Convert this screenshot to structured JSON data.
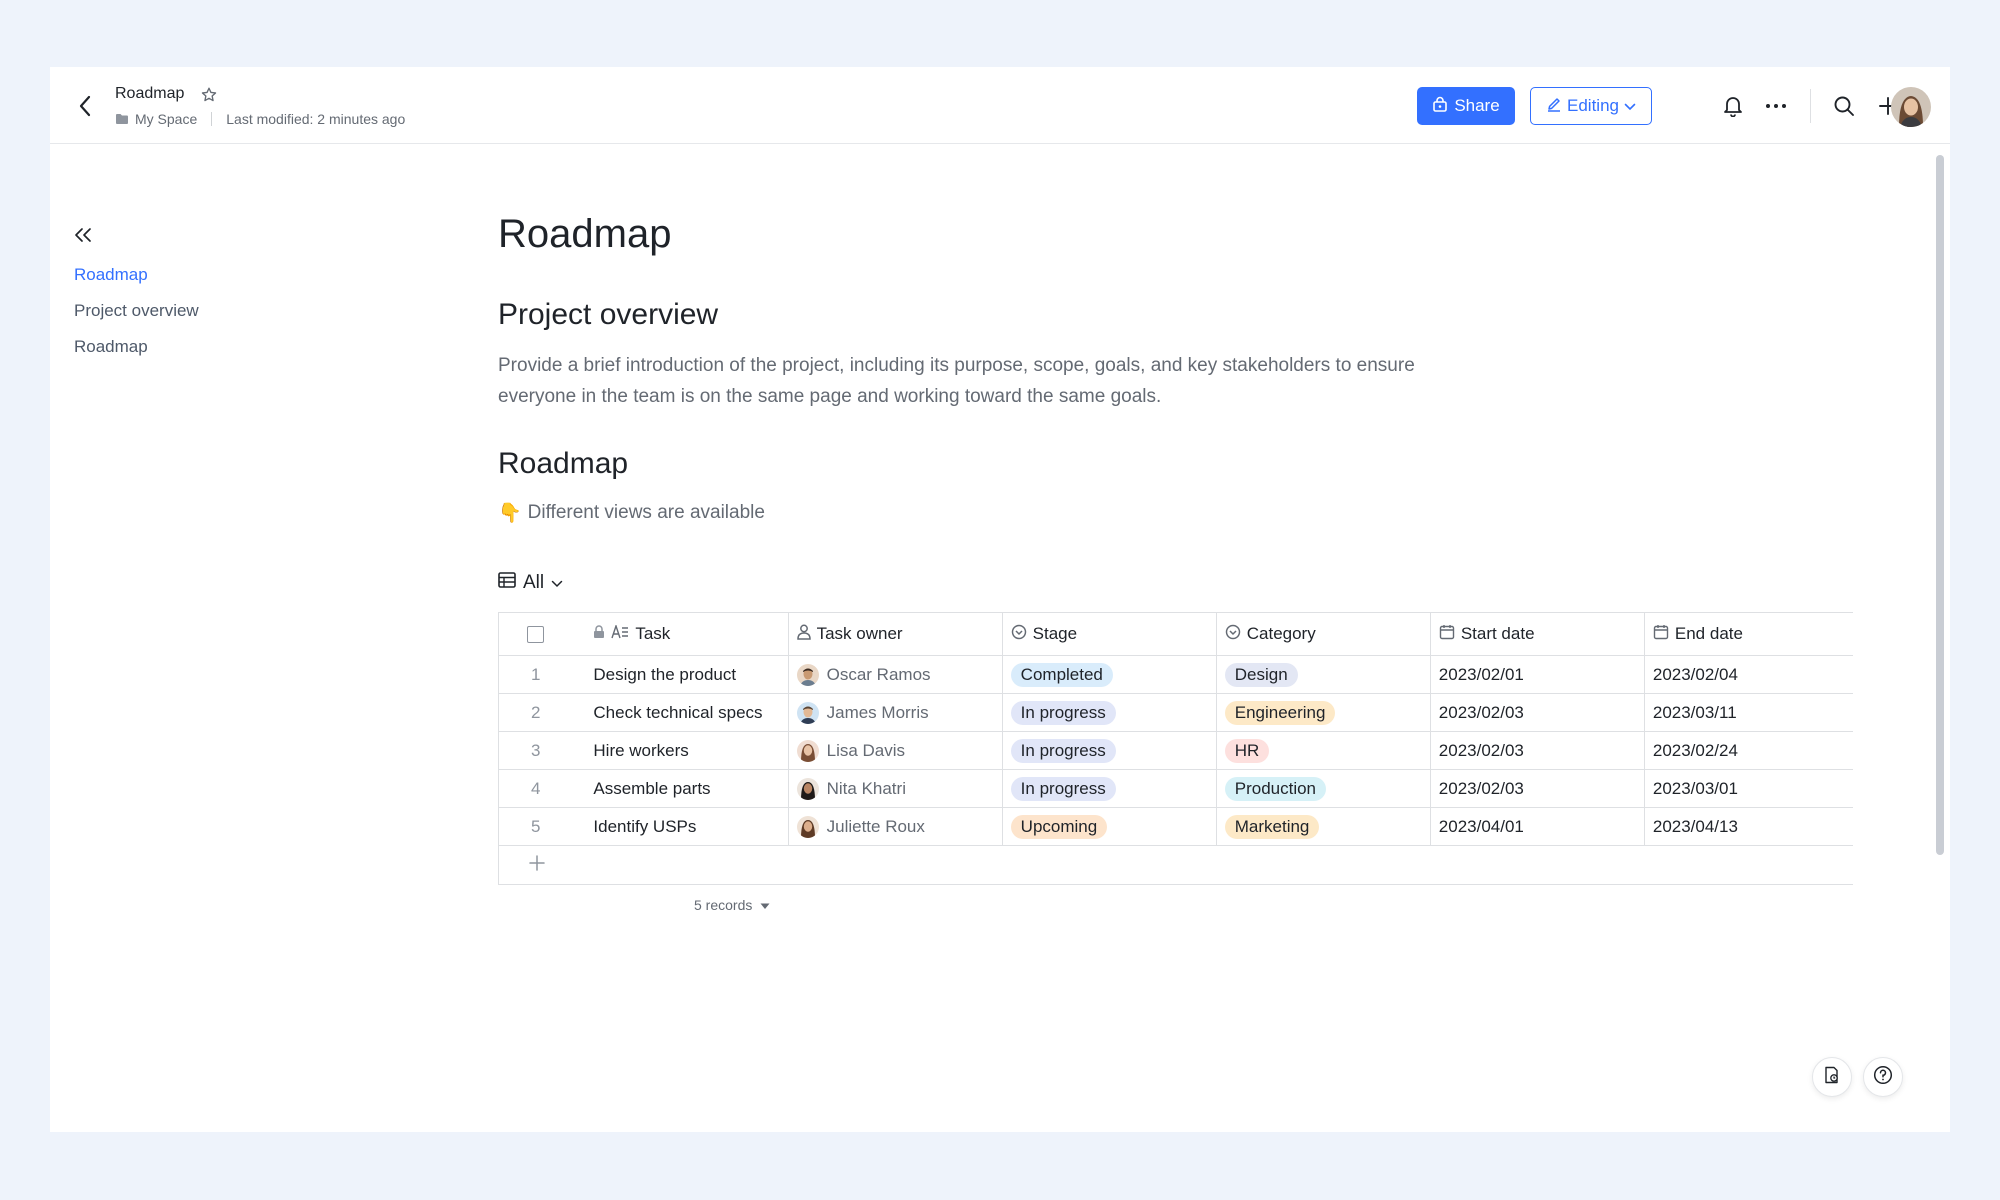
{
  "header": {
    "title": "Roadmap",
    "breadcrumb_space": "My Space",
    "last_modified": "Last modified: 2 minutes ago",
    "share_label": "Share",
    "editing_label": "Editing"
  },
  "outline": {
    "items": [
      {
        "label": "Roadmap",
        "active": true
      },
      {
        "label": "Project overview",
        "active": false
      },
      {
        "label": "Roadmap",
        "active": false
      }
    ]
  },
  "doc": {
    "title": "Roadmap",
    "section1_heading": "Project overview",
    "section1_text": "Provide a brief introduction of the project, including its purpose, scope, goals, and key stakeholders to ensure everyone in the team is on the same page and working toward the same goals.",
    "section2_heading": "Roadmap",
    "note_emoji": "👇",
    "note_text": "Different views are available"
  },
  "table": {
    "view_label": "All",
    "columns": [
      "Task",
      "Task owner",
      "Stage",
      "Category",
      "Start date",
      "End date"
    ],
    "rows": [
      {
        "idx": "1",
        "task": "Design the product",
        "owner": "Oscar Ramos",
        "stage": "Completed",
        "category": "Design",
        "start": "2023/02/01",
        "end": "2023/02/04"
      },
      {
        "idx": "2",
        "task": "Check technical specs",
        "owner": "James Morris",
        "stage": "In progress",
        "category": "Engineering",
        "start": "2023/02/03",
        "end": "2023/03/11"
      },
      {
        "idx": "3",
        "task": "Hire workers",
        "owner": "Lisa Davis",
        "stage": "In progress",
        "category": "HR",
        "start": "2023/02/03",
        "end": "2023/02/24"
      },
      {
        "idx": "4",
        "task": "Assemble parts",
        "owner": "Nita Khatri",
        "stage": "In progress",
        "category": "Production",
        "start": "2023/02/03",
        "end": "2023/03/01"
      },
      {
        "idx": "5",
        "task": "Identify USPs",
        "owner": "Juliette Roux",
        "stage": "Upcoming",
        "category": "Marketing",
        "start": "2023/04/01",
        "end": "2023/04/13"
      }
    ],
    "records_label": "5 records"
  },
  "colors": {
    "accent": "#3370ff",
    "stage": {
      "Completed": "#d9ecfb",
      "In progress": "#e1e6f8",
      "Upcoming": "#fde4cc"
    },
    "category": {
      "Design": "#e3e7f4",
      "Engineering": "#fde9c7",
      "HR": "#fde0de",
      "Production": "#d6f1f7",
      "Marketing": "#fde9c7"
    }
  }
}
